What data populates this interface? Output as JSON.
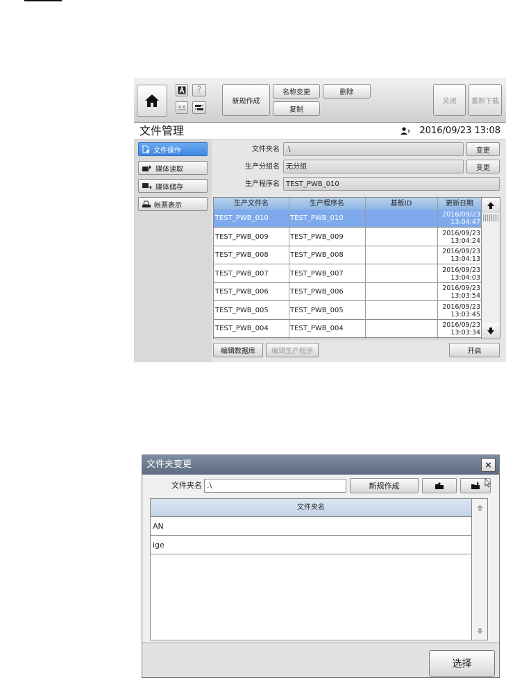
{
  "main": {
    "toolbar": {
      "new_label": "新规作成",
      "rename_label": "名称变更",
      "delete_label": "删除",
      "copy_label": "复制",
      "close_label": "关闭",
      "redownload_label": "重新下载",
      "help_glyph": "?"
    },
    "header": {
      "title": "文件管理",
      "datetime": "2016/09/23 13:08"
    },
    "sidebar": {
      "items": [
        {
          "label": "文件操作",
          "icon": "file-icon",
          "active": true
        },
        {
          "label": "媒体读取",
          "icon": "media-read-icon",
          "active": false
        },
        {
          "label": "媒体储存",
          "icon": "media-save-icon",
          "active": false
        },
        {
          "label": "帐票表示",
          "icon": "printer-icon",
          "active": false
        }
      ]
    },
    "form": {
      "folder_label": "文件夹名",
      "folder_value": ".\\",
      "folder_change": "变更",
      "group_label": "生产分组名",
      "group_value": "无分组",
      "group_change": "变更",
      "program_label": "生产程序名",
      "program_value": "TEST_PWB_010"
    },
    "table": {
      "columns": [
        "生产文件名",
        "生产程序名",
        "基板ID",
        "更新日期"
      ],
      "rows": [
        {
          "file": "TEST_PWB_010",
          "program": "TEST_PWB_010",
          "board": "",
          "date": "2016/09/23",
          "time": "13:04:47",
          "selected": true
        },
        {
          "file": "TEST_PWB_009",
          "program": "TEST_PWB_009",
          "board": "",
          "date": "2016/09/23",
          "time": "13:04:24",
          "selected": false
        },
        {
          "file": "TEST_PWB_008",
          "program": "TEST_PWB_008",
          "board": "",
          "date": "2016/09/23",
          "time": "13:04:13",
          "selected": false
        },
        {
          "file": "TEST_PWB_007",
          "program": "TEST_PWB_007",
          "board": "",
          "date": "2016/09/23",
          "time": "13:04:03",
          "selected": false
        },
        {
          "file": "TEST_PWB_006",
          "program": "TEST_PWB_006",
          "board": "",
          "date": "2016/09/23",
          "time": "13:03:54",
          "selected": false
        },
        {
          "file": "TEST_PWB_005",
          "program": "TEST_PWB_005",
          "board": "",
          "date": "2016/09/23",
          "time": "13:03:45",
          "selected": false
        },
        {
          "file": "TEST_PWB_004",
          "program": "TEST_PWB_004",
          "board": "",
          "date": "2016/09/23",
          "time": "13:03:34",
          "selected": false
        }
      ]
    },
    "bottom": {
      "edit_db": "编辑数据库",
      "edit_program": "编辑生产程序",
      "open": "开启"
    }
  },
  "dialog": {
    "title": "文件夹变更",
    "close_glyph": "×",
    "folder_label": "文件夹名",
    "folder_value": ".\\",
    "new_label": "新规作成",
    "grid_header": "文件夹名",
    "items": [
      "AN",
      "ige"
    ],
    "select_label": "选择"
  },
  "colors": {
    "accent": "#3f86e0",
    "selection": "#7eaaed",
    "header_blue": "#9dc0e8",
    "dialog_title": "#6a788c"
  }
}
